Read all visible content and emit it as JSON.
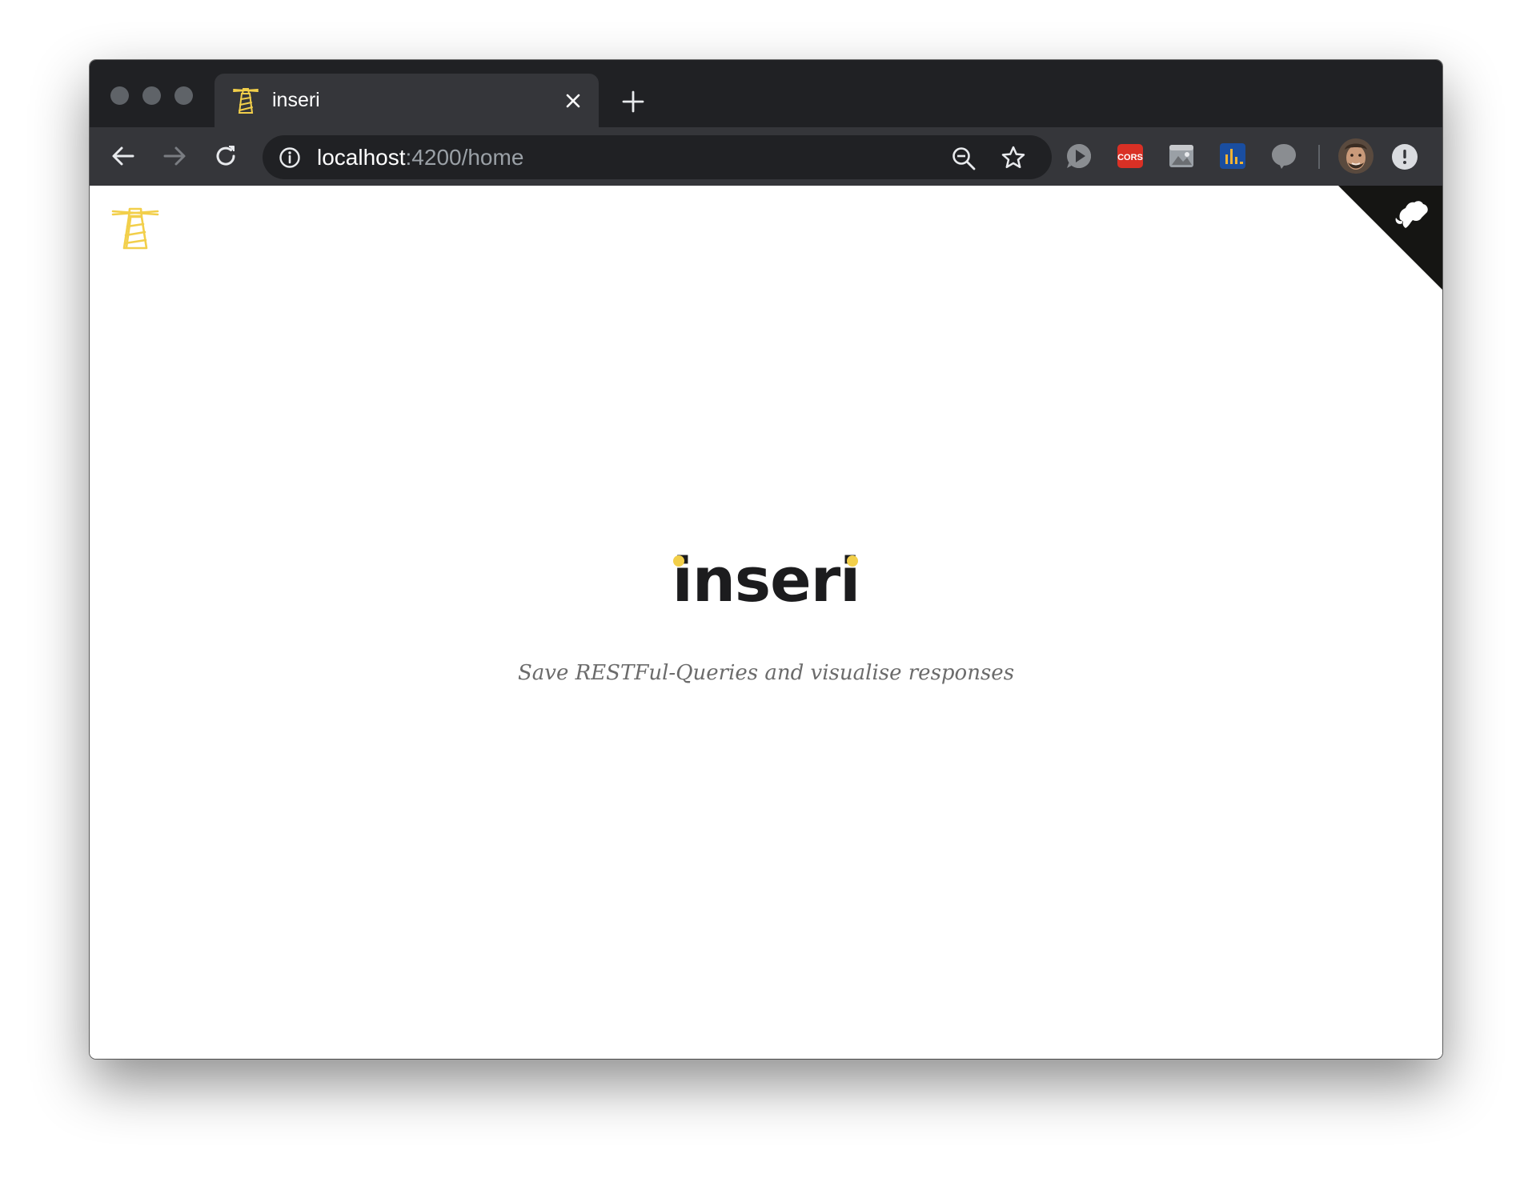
{
  "browser": {
    "tab": {
      "title": "inseri"
    },
    "address_bar": {
      "host": "localhost",
      "path": ":4200/home"
    },
    "extensions": [
      {
        "name": "play-extension-icon"
      },
      {
        "name": "cors-extension-icon",
        "label": "CORS"
      },
      {
        "name": "image-extension-icon"
      },
      {
        "name": "chart-extension-icon"
      },
      {
        "name": "speech-bubble-extension-icon"
      }
    ]
  },
  "page": {
    "hero": {
      "title": "inseri",
      "subtitle": "Save RESTFul-Queries and visualise responses"
    }
  },
  "colors": {
    "brand_yellow": "#f2cf4a",
    "chrome_dark": "#202124",
    "chrome_mid": "#35363a",
    "cors_red": "#d93025",
    "chart_blue": "#1a4ea0"
  }
}
